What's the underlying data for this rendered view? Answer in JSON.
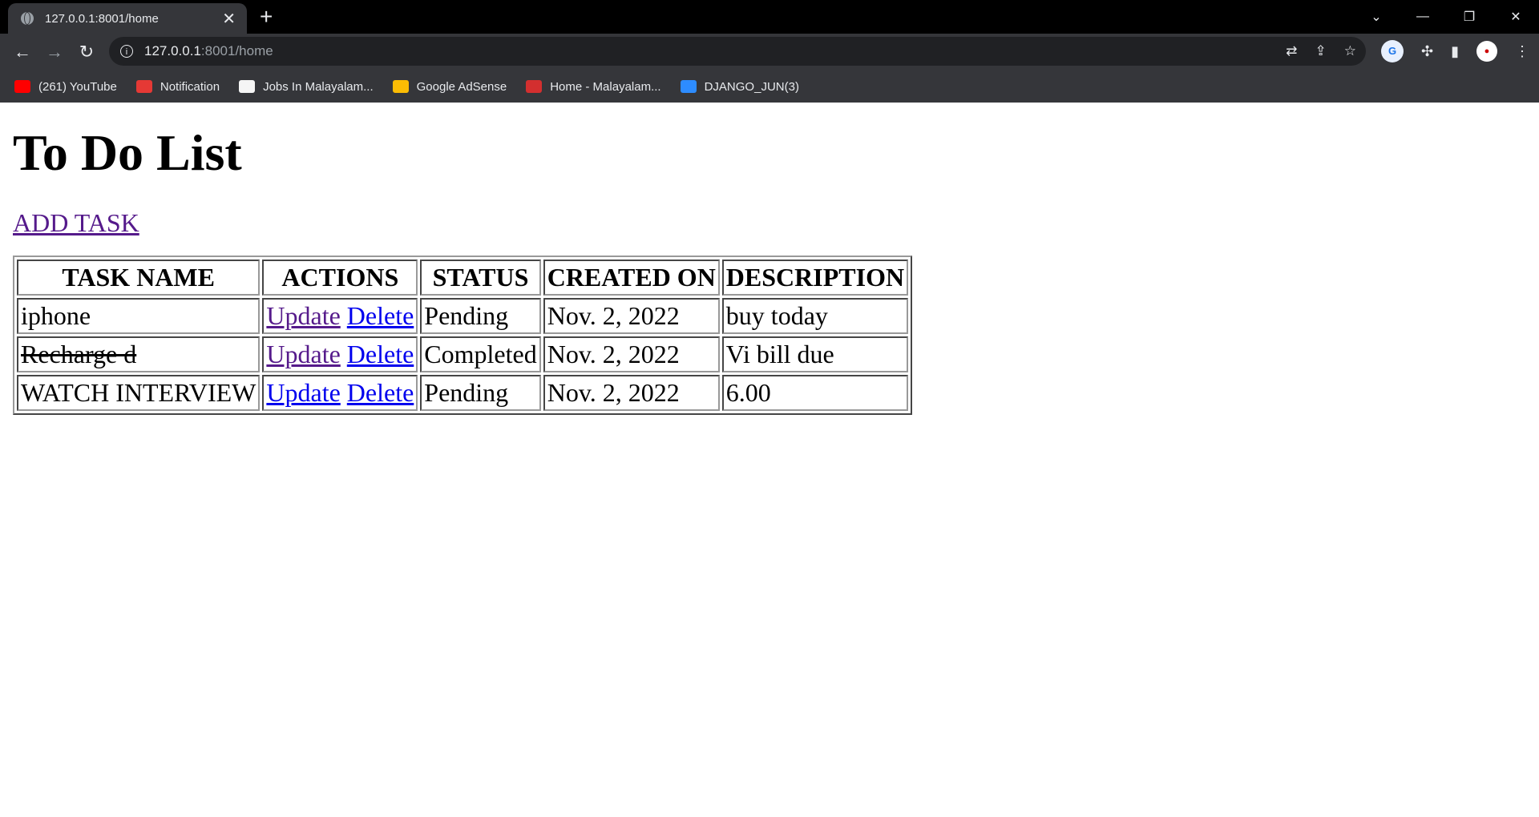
{
  "browser": {
    "tab_title": "127.0.0.1:8001/home",
    "tab_close": "✕",
    "new_tab": "+",
    "url_host": "127.0.0.1",
    "url_path": ":8001/home",
    "bookmarks": [
      {
        "label": "(261) YouTube",
        "icon_color": "#ff0000"
      },
      {
        "label": "Notification",
        "icon_color": "#e53935"
      },
      {
        "label": "Jobs In Malayalam...",
        "icon_color": "#f5f5f5"
      },
      {
        "label": "Google AdSense",
        "icon_color": "#fbbc04"
      },
      {
        "label": "Home - Malayalam...",
        "icon_color": "#d32f2f"
      },
      {
        "label": "DJANGO_JUN(3)",
        "icon_color": "#2d8cff"
      }
    ]
  },
  "page": {
    "title": "To Do List",
    "add_task": "ADD TASK"
  },
  "table": {
    "headers": [
      "TASK NAME",
      "ACTIONS",
      "STATUS",
      "CREATED ON",
      "DESCRIPTION"
    ],
    "update_label": "Update",
    "delete_label": "Delete",
    "rows": [
      {
        "name": "iphone",
        "status": "Pending",
        "created": "Nov. 2, 2022",
        "description": "buy today",
        "completed": false
      },
      {
        "name": "Recharge d",
        "status": "Completed",
        "created": "Nov. 2, 2022",
        "description": "Vi bill due",
        "completed": true
      },
      {
        "name": "WATCH INTERVIEW",
        "status": "Pending",
        "created": "Nov. 2, 2022",
        "description": "6.00",
        "completed": false
      }
    ]
  }
}
